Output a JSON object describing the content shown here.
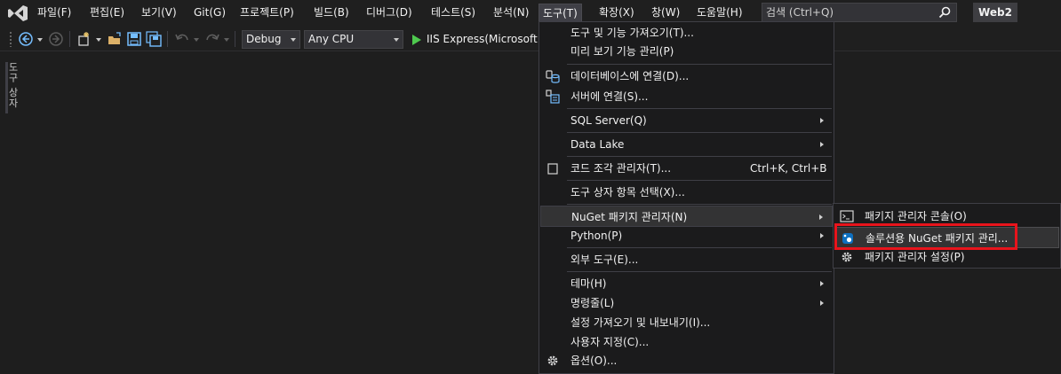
{
  "menubar": {
    "items": [
      "파일(F)",
      "편집(E)",
      "보기(V)",
      "Git(G)",
      "프로젝트(P)",
      "빌드(B)",
      "디버그(D)",
      "테스트(S)",
      "분석(N)",
      "도구(T)",
      "확장(X)",
      "창(W)",
      "도움말(H)"
    ],
    "active_item": "도구(T)",
    "search_placeholder": "검색 (Ctrl+Q)",
    "solution_name": "Web2"
  },
  "toolbar": {
    "configuration": "Debug",
    "platform": "Any CPU",
    "run_target": "IIS Express(Microsoft Edge)"
  },
  "toolbox": {
    "label": "도구 상자"
  },
  "tools_menu": {
    "items": [
      {
        "label": "도구 및 기능 가져오기(T)...",
        "shortcut": "",
        "submenu": false,
        "icon": ""
      },
      {
        "label": "미리 보기 기능 관리(P)",
        "shortcut": "",
        "submenu": false,
        "icon": ""
      },
      {
        "label": "데이터베이스에 연결(D)...",
        "shortcut": "",
        "submenu": false,
        "icon": "database-connect-icon"
      },
      {
        "label": "서버에 연결(S)...",
        "shortcut": "",
        "submenu": false,
        "icon": "server-connect-icon"
      },
      {
        "label": "SQL Server(Q)",
        "shortcut": "",
        "submenu": true,
        "icon": ""
      },
      {
        "label": "Data Lake",
        "shortcut": "",
        "submenu": true,
        "icon": ""
      },
      {
        "label": "코드 조각 관리자(T)...",
        "shortcut": "Ctrl+K, Ctrl+B",
        "submenu": false,
        "icon": "code-snippet-icon"
      },
      {
        "label": "도구 상자 항목 선택(X)...",
        "shortcut": "",
        "submenu": false,
        "icon": ""
      },
      {
        "label": "NuGet 패키지 관리자(N)",
        "shortcut": "",
        "submenu": true,
        "icon": ""
      },
      {
        "label": "Python(P)",
        "shortcut": "",
        "submenu": true,
        "icon": ""
      },
      {
        "label": "외부 도구(E)...",
        "shortcut": "",
        "submenu": false,
        "icon": ""
      },
      {
        "label": "테마(H)",
        "shortcut": "",
        "submenu": true,
        "icon": ""
      },
      {
        "label": "명령줄(L)",
        "shortcut": "",
        "submenu": true,
        "icon": ""
      },
      {
        "label": "설정 가져오기 및 내보내기(I)...",
        "shortcut": "",
        "submenu": false,
        "icon": ""
      },
      {
        "label": "사용자 지정(C)...",
        "shortcut": "",
        "submenu": false,
        "icon": ""
      },
      {
        "label": "옵션(O)...",
        "shortcut": "",
        "submenu": false,
        "icon": "gear-icon"
      }
    ],
    "hovered": "NuGet 패키지 관리자(N)"
  },
  "nuget_submenu": {
    "items": [
      {
        "label": "패키지 관리자 콘솔(O)",
        "icon": "console-icon"
      },
      {
        "label": "솔루션용 NuGet 패키지 관리...",
        "icon": "nuget-icon"
      },
      {
        "label": "패키지 관리자 설정(P)",
        "icon": "gear-icon"
      }
    ],
    "hovered": "솔루션용 NuGet 패키지 관리..."
  },
  "colors": {
    "highlight_box": "#e8141c",
    "accent_blue": "#0e70c0",
    "run_green": "#4ec94e"
  }
}
